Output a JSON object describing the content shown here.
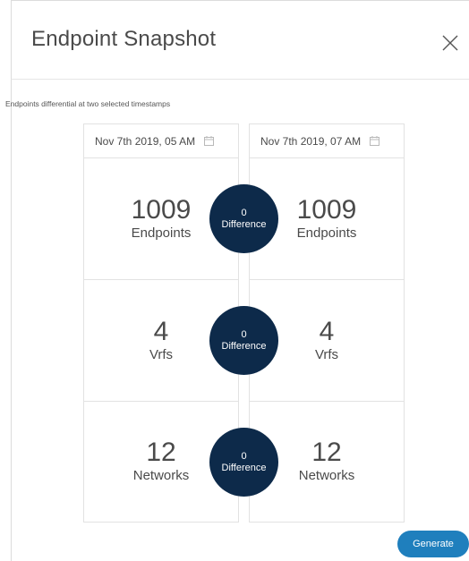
{
  "dialog": {
    "title": "Endpoint Snapshot",
    "close_glyph": "X",
    "subtitle": "Endpoints differential at two selected timestamps"
  },
  "snapshots": [
    {
      "date": "Nov 7th 2019, 05 AM",
      "icon": "calendar-icon",
      "metrics": [
        {
          "value": "1009",
          "label": "Endpoints"
        },
        {
          "value": "4",
          "label": "Vrfs"
        },
        {
          "value": "12",
          "label": "Networks"
        }
      ]
    },
    {
      "date": "Nov 7th 2019, 07 AM",
      "icon": "calendar-icon",
      "metrics": [
        {
          "value": "1009",
          "label": "Endpoints"
        },
        {
          "value": "4",
          "label": "Vrfs"
        },
        {
          "value": "12",
          "label": "Networks"
        }
      ]
    }
  ],
  "differences": [
    {
      "value": "0",
      "label": "Difference"
    },
    {
      "value": "0",
      "label": "Difference"
    },
    {
      "value": "0",
      "label": "Difference"
    }
  ],
  "footer": {
    "generate_label": "Generate"
  },
  "colors": {
    "difference_circle": "#0d2a4a",
    "primary_button": "#1f7fbd"
  }
}
